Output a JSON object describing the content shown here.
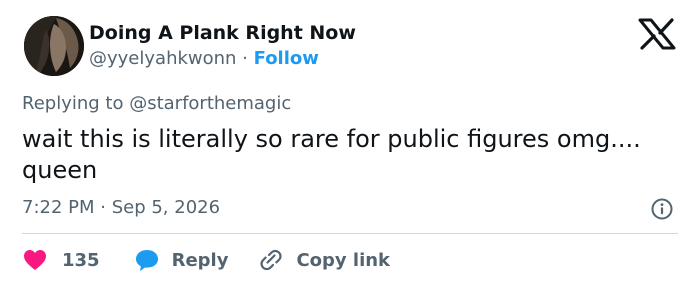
{
  "author": {
    "display_name": "Doing A Plank Right Now",
    "handle": "@yyelyahkwonn",
    "separator": " · ",
    "follow_label": "Follow",
    "avatar_icon": "profile-photo"
  },
  "brand": {
    "logo_icon": "x-logo-icon"
  },
  "tweet": {
    "reply_prefix": "Replying to ",
    "reply_to": "@starforthemagic",
    "text": "wait this is literally so rare for public figures omg.... queen",
    "timestamp": "7:22 PM · Sep 5, 2026",
    "info_icon": "info-icon"
  },
  "actions": {
    "like_count": "135",
    "reply_label": "Reply",
    "copy_label": "Copy link",
    "icons": [
      "heart-icon",
      "speech-bubble-icon",
      "link-icon"
    ]
  },
  "colors": {
    "text": "#0f1419",
    "muted": "#536471",
    "accent": "#1d9bf0",
    "like": "#f91880",
    "divider": "#cfd9de"
  }
}
